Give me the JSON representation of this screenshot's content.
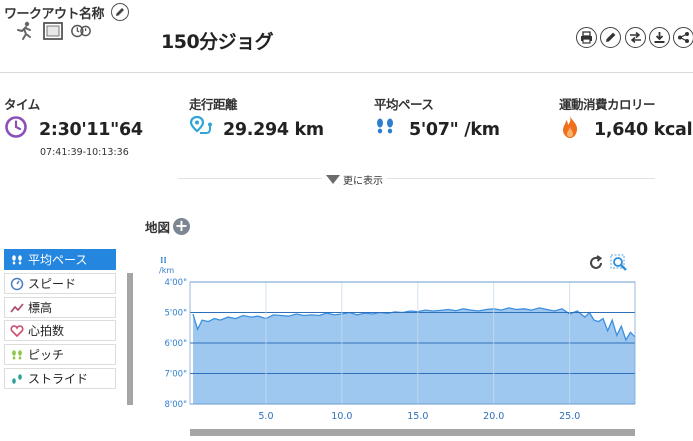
{
  "header": {
    "section_label": "ワークアウト名称",
    "workout_title": "150分ジョグ",
    "activity_icons": [
      "runner-icon",
      "film-icon",
      "stopwatch-icon"
    ],
    "tool_icons": [
      "print-icon",
      "edit-icon",
      "swap-icon",
      "download-icon",
      "share-icon"
    ]
  },
  "stats": [
    {
      "label": "タイム",
      "value": "2:30'11\"64",
      "icon": "clock-icon",
      "sub": "07:41:39-10:13:36"
    },
    {
      "label": "走行距離",
      "value": "29.294 km",
      "icon": "route-pin-icon"
    },
    {
      "label": "平均ペース",
      "value": "5'07\" /km",
      "icon": "footprints-icon"
    },
    {
      "label": "運動消費カロリー",
      "value": "1,640 kcal",
      "icon": "flame-icon"
    }
  ],
  "more_label": "更に表示",
  "map_label": "地図",
  "metrics": [
    {
      "label": "平均ペース",
      "icon": "footprints-icon",
      "active": true
    },
    {
      "label": "スピード",
      "icon": "speedometer-icon",
      "active": false
    },
    {
      "label": "標高",
      "icon": "trend-icon",
      "active": false
    },
    {
      "label": "心拍数",
      "icon": "heart-icon",
      "active": false
    },
    {
      "label": "ピッチ",
      "icon": "footprints-icon",
      "active": false
    },
    {
      "label": "ストライド",
      "icon": "stride-icon",
      "active": false
    }
  ],
  "chart_data": {
    "type": "area",
    "title": "",
    "ylabel": "/km",
    "xlabel": "",
    "y_inverted": true,
    "ylim": [
      4,
      8
    ],
    "xlim": [
      0,
      29.3
    ],
    "y_ticks": [
      "4'00\"",
      "5'00\"",
      "6'00\"",
      "7'00\"",
      "8'00\""
    ],
    "x_ticks": [
      "5.0",
      "10.0",
      "15.0",
      "20.0",
      "25.0"
    ],
    "grid": true,
    "colors": {
      "fill": "#9fc8f0",
      "line": "#3b8fe0",
      "grid": "#2f6fb8"
    },
    "x": [
      0.2,
      0.5,
      0.8,
      1.2,
      1.6,
      2.0,
      2.5,
      3.0,
      3.5,
      4.0,
      4.5,
      5.0,
      5.5,
      6.0,
      6.5,
      7.0,
      7.5,
      8.0,
      8.5,
      9.0,
      9.5,
      10.0,
      10.5,
      11.0,
      11.5,
      12.0,
      12.5,
      13.0,
      13.5,
      14.0,
      14.5,
      15.0,
      15.5,
      16.0,
      16.5,
      17.0,
      17.5,
      18.0,
      18.5,
      19.0,
      19.5,
      20.0,
      20.5,
      21.0,
      21.5,
      22.0,
      22.5,
      23.0,
      23.5,
      24.0,
      24.5,
      25.0,
      25.5,
      26.0,
      26.3,
      26.6,
      26.9,
      27.2,
      27.5,
      27.8,
      28.1,
      28.4,
      28.7,
      29.0,
      29.3
    ],
    "values": [
      5.05,
      5.55,
      5.25,
      5.3,
      5.2,
      5.25,
      5.15,
      5.2,
      5.1,
      5.15,
      5.12,
      5.2,
      5.08,
      5.1,
      5.12,
      5.05,
      5.1,
      5.08,
      5.1,
      5.02,
      5.08,
      5.05,
      5.0,
      5.08,
      5.02,
      5.05,
      5.0,
      5.03,
      4.98,
      5.0,
      4.95,
      4.97,
      4.92,
      4.95,
      4.93,
      4.9,
      4.94,
      4.88,
      4.92,
      4.95,
      4.9,
      4.88,
      4.92,
      4.85,
      4.9,
      4.88,
      4.92,
      4.85,
      4.9,
      4.95,
      4.88,
      5.05,
      4.95,
      5.15,
      5.0,
      5.25,
      5.3,
      5.2,
      5.6,
      5.25,
      5.75,
      5.45,
      5.9,
      5.65,
      5.8
    ]
  }
}
